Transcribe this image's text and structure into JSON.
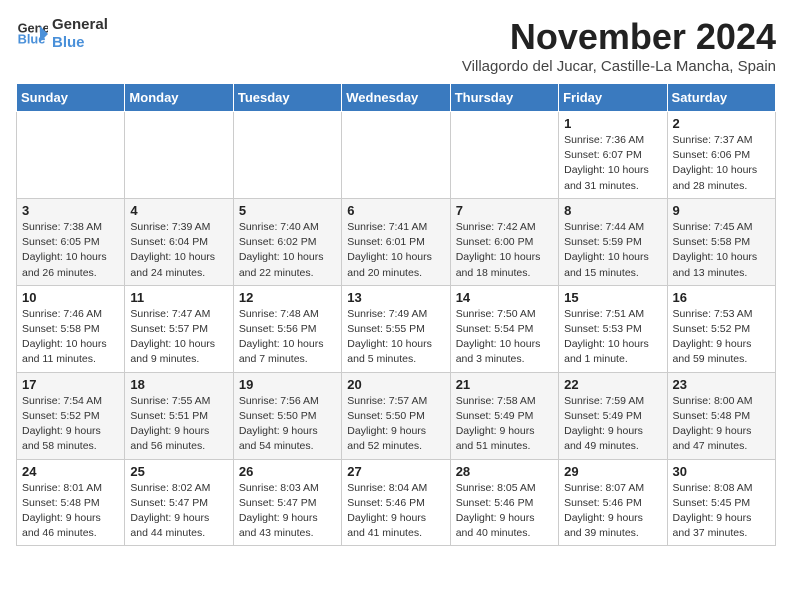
{
  "logo": {
    "line1": "General",
    "line2": "Blue"
  },
  "title": "November 2024",
  "location": "Villagordo del Jucar, Castille-La Mancha, Spain",
  "days_of_week": [
    "Sunday",
    "Monday",
    "Tuesday",
    "Wednesday",
    "Thursday",
    "Friday",
    "Saturday"
  ],
  "weeks": [
    [
      {
        "day": "",
        "info": ""
      },
      {
        "day": "",
        "info": ""
      },
      {
        "day": "",
        "info": ""
      },
      {
        "day": "",
        "info": ""
      },
      {
        "day": "",
        "info": ""
      },
      {
        "day": "1",
        "info": "Sunrise: 7:36 AM\nSunset: 6:07 PM\nDaylight: 10 hours and 31 minutes."
      },
      {
        "day": "2",
        "info": "Sunrise: 7:37 AM\nSunset: 6:06 PM\nDaylight: 10 hours and 28 minutes."
      }
    ],
    [
      {
        "day": "3",
        "info": "Sunrise: 7:38 AM\nSunset: 6:05 PM\nDaylight: 10 hours and 26 minutes."
      },
      {
        "day": "4",
        "info": "Sunrise: 7:39 AM\nSunset: 6:04 PM\nDaylight: 10 hours and 24 minutes."
      },
      {
        "day": "5",
        "info": "Sunrise: 7:40 AM\nSunset: 6:02 PM\nDaylight: 10 hours and 22 minutes."
      },
      {
        "day": "6",
        "info": "Sunrise: 7:41 AM\nSunset: 6:01 PM\nDaylight: 10 hours and 20 minutes."
      },
      {
        "day": "7",
        "info": "Sunrise: 7:42 AM\nSunset: 6:00 PM\nDaylight: 10 hours and 18 minutes."
      },
      {
        "day": "8",
        "info": "Sunrise: 7:44 AM\nSunset: 5:59 PM\nDaylight: 10 hours and 15 minutes."
      },
      {
        "day": "9",
        "info": "Sunrise: 7:45 AM\nSunset: 5:58 PM\nDaylight: 10 hours and 13 minutes."
      }
    ],
    [
      {
        "day": "10",
        "info": "Sunrise: 7:46 AM\nSunset: 5:58 PM\nDaylight: 10 hours and 11 minutes."
      },
      {
        "day": "11",
        "info": "Sunrise: 7:47 AM\nSunset: 5:57 PM\nDaylight: 10 hours and 9 minutes."
      },
      {
        "day": "12",
        "info": "Sunrise: 7:48 AM\nSunset: 5:56 PM\nDaylight: 10 hours and 7 minutes."
      },
      {
        "day": "13",
        "info": "Sunrise: 7:49 AM\nSunset: 5:55 PM\nDaylight: 10 hours and 5 minutes."
      },
      {
        "day": "14",
        "info": "Sunrise: 7:50 AM\nSunset: 5:54 PM\nDaylight: 10 hours and 3 minutes."
      },
      {
        "day": "15",
        "info": "Sunrise: 7:51 AM\nSunset: 5:53 PM\nDaylight: 10 hours and 1 minute."
      },
      {
        "day": "16",
        "info": "Sunrise: 7:53 AM\nSunset: 5:52 PM\nDaylight: 9 hours and 59 minutes."
      }
    ],
    [
      {
        "day": "17",
        "info": "Sunrise: 7:54 AM\nSunset: 5:52 PM\nDaylight: 9 hours and 58 minutes."
      },
      {
        "day": "18",
        "info": "Sunrise: 7:55 AM\nSunset: 5:51 PM\nDaylight: 9 hours and 56 minutes."
      },
      {
        "day": "19",
        "info": "Sunrise: 7:56 AM\nSunset: 5:50 PM\nDaylight: 9 hours and 54 minutes."
      },
      {
        "day": "20",
        "info": "Sunrise: 7:57 AM\nSunset: 5:50 PM\nDaylight: 9 hours and 52 minutes."
      },
      {
        "day": "21",
        "info": "Sunrise: 7:58 AM\nSunset: 5:49 PM\nDaylight: 9 hours and 51 minutes."
      },
      {
        "day": "22",
        "info": "Sunrise: 7:59 AM\nSunset: 5:49 PM\nDaylight: 9 hours and 49 minutes."
      },
      {
        "day": "23",
        "info": "Sunrise: 8:00 AM\nSunset: 5:48 PM\nDaylight: 9 hours and 47 minutes."
      }
    ],
    [
      {
        "day": "24",
        "info": "Sunrise: 8:01 AM\nSunset: 5:48 PM\nDaylight: 9 hours and 46 minutes."
      },
      {
        "day": "25",
        "info": "Sunrise: 8:02 AM\nSunset: 5:47 PM\nDaylight: 9 hours and 44 minutes."
      },
      {
        "day": "26",
        "info": "Sunrise: 8:03 AM\nSunset: 5:47 PM\nDaylight: 9 hours and 43 minutes."
      },
      {
        "day": "27",
        "info": "Sunrise: 8:04 AM\nSunset: 5:46 PM\nDaylight: 9 hours and 41 minutes."
      },
      {
        "day": "28",
        "info": "Sunrise: 8:05 AM\nSunset: 5:46 PM\nDaylight: 9 hours and 40 minutes."
      },
      {
        "day": "29",
        "info": "Sunrise: 8:07 AM\nSunset: 5:46 PM\nDaylight: 9 hours and 39 minutes."
      },
      {
        "day": "30",
        "info": "Sunrise: 8:08 AM\nSunset: 5:45 PM\nDaylight: 9 hours and 37 minutes."
      }
    ]
  ]
}
